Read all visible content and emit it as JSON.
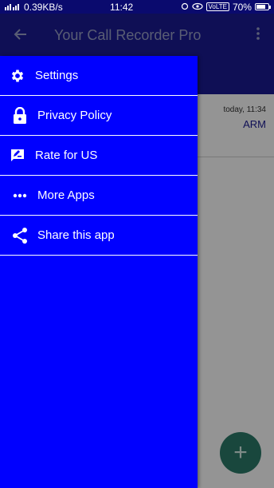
{
  "status_bar": {
    "network_speed": "0.39KB/s",
    "time": "11:42",
    "volte": "VoLTE",
    "battery": "70%"
  },
  "toolbar": {
    "back_icon": "arrow-left-icon",
    "title": "Your Call Recorder Pro",
    "menu_icon": "more-vert-icon"
  },
  "recording": {
    "time": "today, 11:34",
    "name": "ARM"
  },
  "fab": {
    "icon": "plus-icon",
    "label": "+"
  },
  "drawer": {
    "items": [
      {
        "label": "Settings",
        "icon": "gear-icon"
      },
      {
        "label": "Privacy Policy",
        "icon": "lock-icon"
      },
      {
        "label": "Rate for US",
        "icon": "rate-review-icon"
      },
      {
        "label": "More Apps",
        "icon": "more-horiz-icon"
      },
      {
        "label": "Share this app",
        "icon": "share-icon"
      }
    ]
  },
  "colors": {
    "drawer_bg": "#0000ff",
    "toolbar_bg": "#1a1a93",
    "fab_bg": "#2c7a6a"
  }
}
